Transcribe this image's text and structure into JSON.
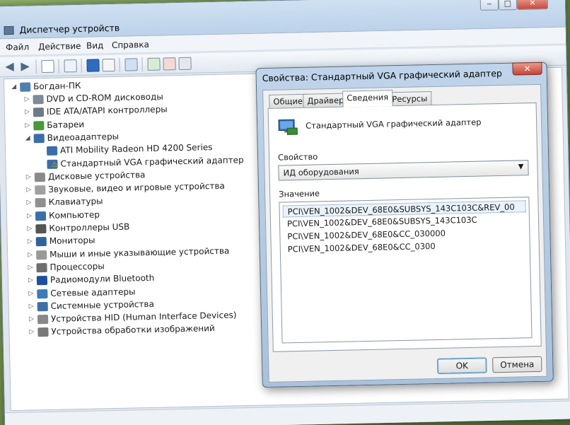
{
  "window": {
    "title": "Диспетчер устройств",
    "minimize": "‒",
    "maximize": "□",
    "close": "✕"
  },
  "menu": [
    "Файл",
    "Действие",
    "Вид",
    "Справка"
  ],
  "toolbar": {
    "back": "◀",
    "forward": "▶"
  },
  "tree": {
    "root": "Богдан-ПК",
    "items": [
      {
        "label": "DVD и CD-ROM дисководы",
        "icon": "dvd-drive-icon",
        "color": "#7d8a98"
      },
      {
        "label": "IDE ATA/ATAPI контроллеры",
        "icon": "ide-controller-icon",
        "color": "#6c7a88"
      },
      {
        "label": "Батареи",
        "icon": "battery-icon",
        "color": "#4a9a3a"
      },
      {
        "label": "Видеоадаптеры",
        "icon": "display-adapter-icon",
        "color": "#3a6ea8",
        "expanded": true
      },
      {
        "label": "ATI Mobility Radeon HD 4200 Series",
        "icon": "display-adapter-icon",
        "color": "#3a6ea8",
        "child": true
      },
      {
        "label": "Стандартный VGA графический адаптер",
        "icon": "display-adapter-warning-icon",
        "color": "#3a6ea8",
        "child": true,
        "warning": true
      },
      {
        "label": "Дисковые устройства",
        "icon": "disk-drive-icon",
        "color": "#8a8a8a"
      },
      {
        "label": "Звуковые, видео и игровые устройства",
        "icon": "sound-device-icon",
        "color": "#a0a0a0"
      },
      {
        "label": "Клавиатуры",
        "icon": "keyboard-icon",
        "color": "#8f8f8f"
      },
      {
        "label": "Компьютер",
        "icon": "computer-icon",
        "color": "#3d6fa6"
      },
      {
        "label": "Контроллеры USB",
        "icon": "usb-controller-icon",
        "color": "#555555"
      },
      {
        "label": "Мониторы",
        "icon": "monitor-icon",
        "color": "#2f63a0"
      },
      {
        "label": "Мыши и иные указывающие устройства",
        "icon": "mouse-icon",
        "color": "#999999"
      },
      {
        "label": "Процессоры",
        "icon": "processor-icon",
        "color": "#6e6e6e"
      },
      {
        "label": "Радиомодули Bluetooth",
        "icon": "bluetooth-icon",
        "color": "#1e4f9c"
      },
      {
        "label": "Сетевые адаптеры",
        "icon": "network-adapter-icon",
        "color": "#3d7ab8"
      },
      {
        "label": "Системные устройства",
        "icon": "system-device-icon",
        "color": "#3d6fa6"
      },
      {
        "label": "Устройства HID (Human Interface Devices)",
        "icon": "hid-device-icon",
        "color": "#888888"
      },
      {
        "label": "Устройства обработки изображений",
        "icon": "imaging-device-icon",
        "color": "#7a7a7a"
      }
    ]
  },
  "dialog": {
    "title": "Свойства: Стандартный VGA графический адаптер",
    "close": "✕",
    "tabs": [
      "Общие",
      "Драйвер",
      "Сведения",
      "Ресурсы"
    ],
    "active_tab": "Сведения",
    "device_name": "Стандартный VGA графический адаптер",
    "property_label": "Свойство",
    "property_value": "ИД оборудования",
    "value_label": "Значение",
    "values": [
      "PCI\\VEN_1002&DEV_68E0&SUBSYS_143C103C&REV_00",
      "PCI\\VEN_1002&DEV_68E0&SUBSYS_143C103C",
      "PCI\\VEN_1002&DEV_68E0&CC_030000",
      "PCI\\VEN_1002&DEV_68E0&CC_0300"
    ],
    "ok": "OK",
    "cancel": "Отмена"
  },
  "colors": {
    "accent": "#3c7fb1",
    "titlebar": "#bcd2ea",
    "close_button": "#c6443a"
  }
}
